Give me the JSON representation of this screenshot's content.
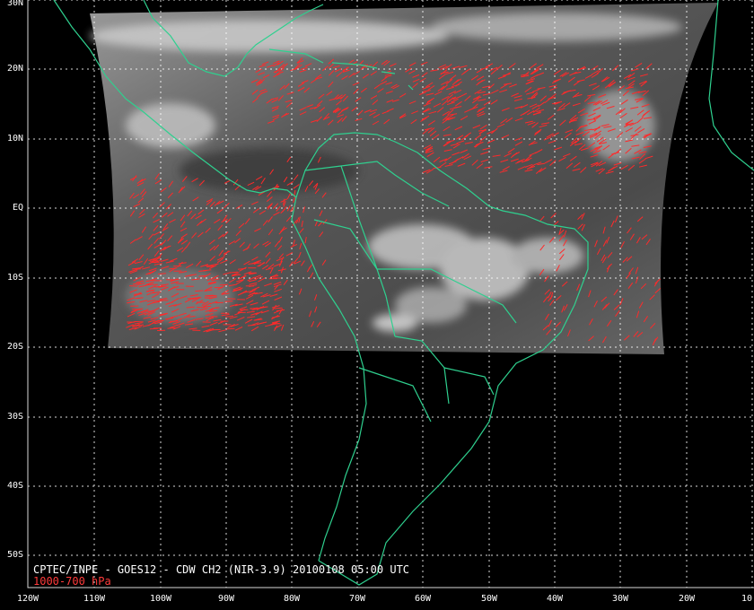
{
  "map": {
    "caption": "CPTEC/INPE - GOES12 - CDW CH2 (NIR-3.9) 20100108 05:00 UTC",
    "level": "1000-700 hPa",
    "lat_labels": [
      "30N",
      "20N",
      "10N",
      "EQ",
      "10S",
      "20S",
      "30S",
      "40S",
      "50S"
    ],
    "lon_labels": [
      "120W",
      "110W",
      "100W",
      "90W",
      "80W",
      "70W",
      "60W",
      "50W",
      "40W",
      "30W",
      "20W",
      "10"
    ],
    "colors": {
      "background": "#000000",
      "coastline": "#2fd08f",
      "wind_vectors": "#ff2a2a",
      "grid": "#ffffff",
      "caption_text": "#ffffff",
      "level_text": "#ff3b3b"
    }
  }
}
